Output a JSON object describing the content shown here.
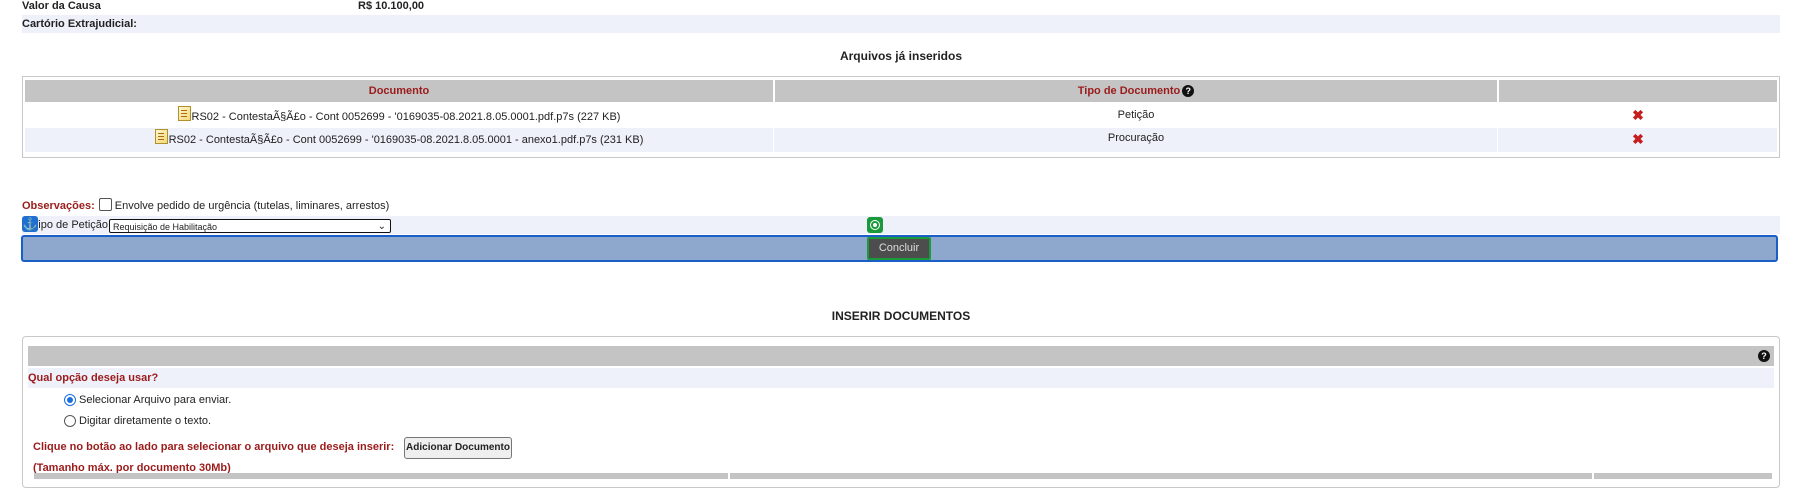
{
  "case": {
    "valor_label": "Valor da Causa",
    "valor_value": "R$ 10.100,00",
    "cartorio_label": "Cartório Extrajudicial:"
  },
  "files": {
    "title": "Arquivos já inseridos",
    "headers": [
      "Documento",
      "Tipo de Documento",
      ""
    ],
    "rows": [
      {
        "name": "RS02 - ContestaÃ§Ã£o - Cont 0052699 - '0169035-08.2021.8.05.0001.pdf.p7s (227 KB)",
        "type": "Petição"
      },
      {
        "name": "RS02 - ContestaÃ§Ã£o - Cont 0052699 - '0169035-08.2021.8.05.0001 - anexo1.pdf.p7s (231 KB)",
        "type": "Procuração"
      }
    ],
    "help_glyph": "?",
    "delete_glyph": "✖"
  },
  "observacoes": {
    "label": "Observações:",
    "checkbox_label": "Envolve pedido de urgência (tutelas, liminares, arrestos)"
  },
  "tipo_peticao": {
    "label": "Tipo de Petição:",
    "selected": "Requisição de Habilitação"
  },
  "concluir_label": "Concluir",
  "insert": {
    "title": "INSERIR DOCUMENTOS",
    "question": "Qual opção deseja usar?",
    "option_file": "Selecionar Arquivo para enviar.",
    "option_text": "Digitar diretamente o texto.",
    "instruction": "Clique no botão ao lado para selecionar o arquivo que deseja inserir:",
    "add_button": "Adicionar Documento",
    "size_note": "(Tamanho máx. por documento 30Mb)"
  }
}
